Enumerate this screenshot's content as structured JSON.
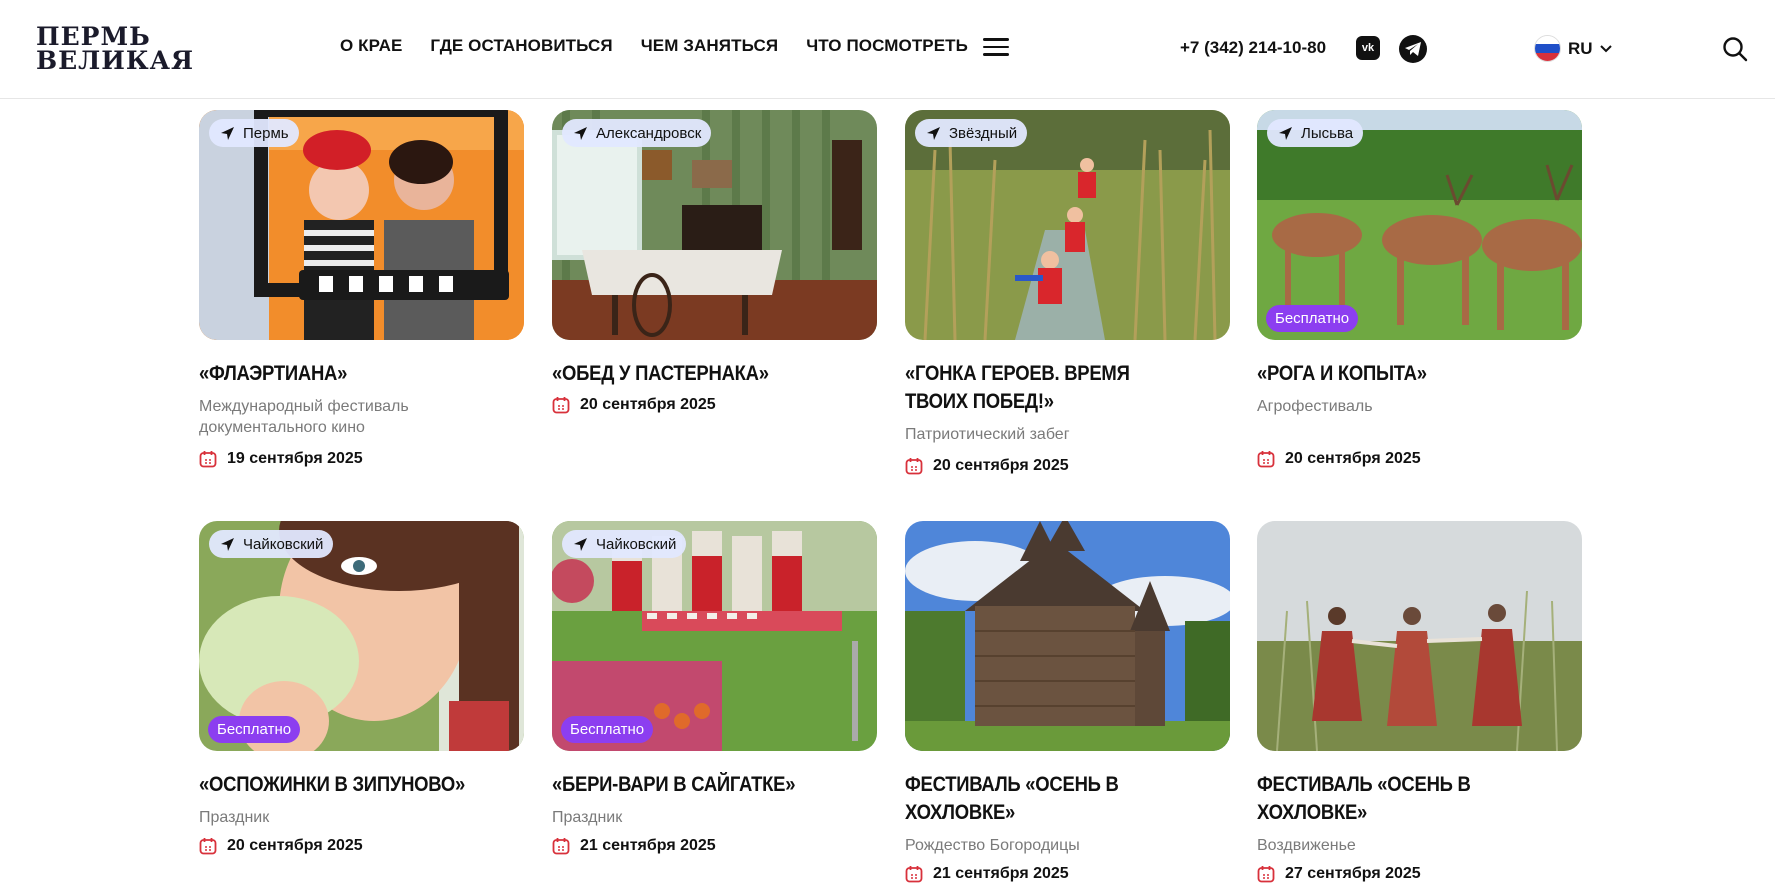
{
  "header": {
    "logo_line1": "ПЕРМЬ",
    "logo_line2": "ВЕЛИКАЯ",
    "nav": [
      "О КРАЕ",
      "ГДЕ ОСТАНОВИТЬСЯ",
      "ЧЕМ ЗАНЯТЬСЯ",
      "ЧТО ПОСМОТРЕТЬ"
    ],
    "phone": "+7 (342) 214-10-80",
    "vk_label": "vk",
    "lang": "RU"
  },
  "colors": {
    "accent_purple": "#8c3ef0",
    "calendar_red": "#d8313b",
    "badge_bg": "#e1e8ff"
  },
  "events": [
    {
      "place": "Пермь",
      "title": "«ФЛАЭРТИАНА»",
      "subtitle": "Международный фестиваль документального кино",
      "date": "19 сентября 2025",
      "free": ""
    },
    {
      "place": "Александровск",
      "title": "«ОБЕД У ПАСТЕРНАКА»",
      "subtitle": "",
      "date": "20 сентября 2025",
      "free": ""
    },
    {
      "place": "Звёздный",
      "title": "«ГОНКА ГЕРОЕВ. ВРЕМЯ ТВОИХ ПОБЕД!»",
      "subtitle": "Патриотический забег",
      "date": "20 сентября 2025",
      "free": ""
    },
    {
      "place": "Лысьва",
      "title": "«РОГА И КОПЫТА»",
      "subtitle": "Агрофестиваль",
      "date": "20 сентября 2025",
      "free": "Бесплатно"
    },
    {
      "place": "Чайковский",
      "title": "«ОСПОЖИНКИ В ЗИПУНОВО»",
      "subtitle": "Праздник",
      "date": "20 сентября 2025",
      "free": "Бесплатно"
    },
    {
      "place": "Чайковский",
      "title": "«БЕРИ-ВАРИ В САЙГАТКЕ»",
      "subtitle": "Праздник",
      "date": "21 сентября 2025",
      "free": "Бесплатно"
    },
    {
      "place": "",
      "title": "ФЕСТИВАЛЬ «ОСЕНЬ В ХОХЛОВКЕ»",
      "subtitle": "Рождество Богородицы",
      "date": "21 сентября 2025",
      "free": ""
    },
    {
      "place": "",
      "title": "ФЕСТИВАЛЬ «ОСЕНЬ В ХОХЛОВКЕ»",
      "subtitle": "Воздвиженье",
      "date": "27 сентября 2025",
      "free": ""
    }
  ]
}
